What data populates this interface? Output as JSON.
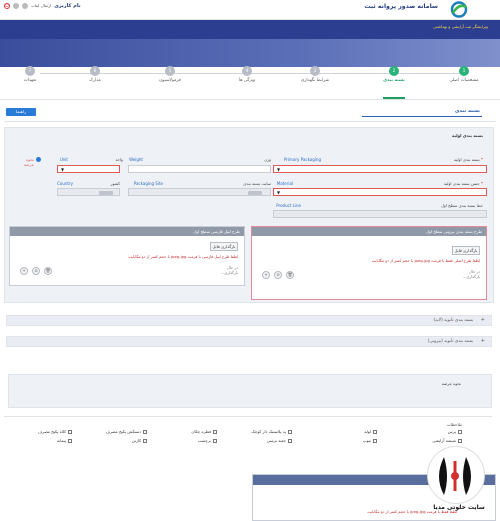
{
  "header": {
    "system_title": "سامانه صدور پروانه ثبت",
    "user_name": "نام کاربری",
    "user_role": "ارسال ایتات"
  },
  "banner": {
    "breadcrumb": "ویرایشگر ثبت آرایشی و بهداشتی"
  },
  "steps": [
    {
      "num": "1",
      "label": "مشخصات اصلی",
      "active": false
    },
    {
      "num": "2",
      "label": "بسته بندی",
      "active": true
    },
    {
      "num": "3",
      "label": "شرایط نگهداری",
      "active": false
    },
    {
      "num": "4",
      "label": "ویژگی ها",
      "active": false
    },
    {
      "num": "5",
      "label": "فرمولاسیون",
      "active": false
    },
    {
      "num": "6",
      "label": "مدارک",
      "active": false
    },
    {
      "num": "7",
      "label": "تعهدات",
      "active": false
    }
  ],
  "section": {
    "title": "بسته بندی",
    "help_button": "راهنما",
    "primary_header": "بسته بندی اولیه"
  },
  "form": {
    "primary_packaging_fa": "بسته بندی اولیه",
    "primary_packaging_en": "Primary Packaging",
    "weight_fa": "وزن",
    "weight_en": "Weight",
    "unit_fa": "واحد",
    "unit_en": "Unit",
    "package_type_label": "نحوه عرضه",
    "material_fa": "جنس بسته بندی اولیه",
    "material_en": "Material",
    "packaging_site_fa": "سایت بسته بندی",
    "packaging_site_en": "Packaging Site",
    "country_fa": "کشور",
    "country_en": "Country",
    "product_line_fa": "خط بسته بندی سطح اول",
    "product_line_en": "Product Line"
  },
  "uploads": [
    {
      "title": "طرح بسته بندی بیرونی سطح اول",
      "button": "بارگذاری فایل",
      "note": "لطفا طرح اصلی فقط با فرمت jpeg-jpg با حجم کمتر از دو مگابایت",
      "status": "در حال بارگذاری..."
    },
    {
      "title": "طرح لیبل فارسی سطح اول",
      "button": "بارگذاری فایل",
      "note": "لطفا طرح لیبل فارسی با فرمت jpeg-jpg با حجم کمتر از دو مگابایت",
      "status": "در حال بارگذاری..."
    }
  ],
  "collapsed_sections": [
    {
      "label": "بسته بندی ثانویه (لایه)"
    },
    {
      "label": "بسته بندی ثانویه (بیرونی)"
    }
  ],
  "description": {
    "label": "نحوه عرضه"
  },
  "checklist": {
    "title": "ملاحظات",
    "items": [
      {
        "label": "پرس",
        "checked": false
      },
      {
        "label": "شیشه آرایشی",
        "checked": false
      },
      {
        "label": "لوله",
        "checked": false
      },
      {
        "label": "تیوپ",
        "checked": false
      },
      {
        "label": "پد پلاستیک دار کوچک",
        "checked": false
      },
      {
        "label": "جعبه تزئینی",
        "checked": false
      },
      {
        "label": "قطره چکان",
        "checked": false
      },
      {
        "label": "برچسب",
        "checked": false
      },
      {
        "label": "دستکش پکیج مصرف",
        "checked": false
      },
      {
        "label": "کارتن",
        "checked": false
      },
      {
        "label": "کلاه پکیج مصرف",
        "checked": false
      },
      {
        "label": "پیمانه",
        "checked": false
      }
    ]
  },
  "bottom": {
    "note": "لطفا فقط با فرمت jpeg-jpg با حجم کمتر از دو مگابایت"
  },
  "watermark": {
    "text": "سایت خلوتی مدیا"
  }
}
